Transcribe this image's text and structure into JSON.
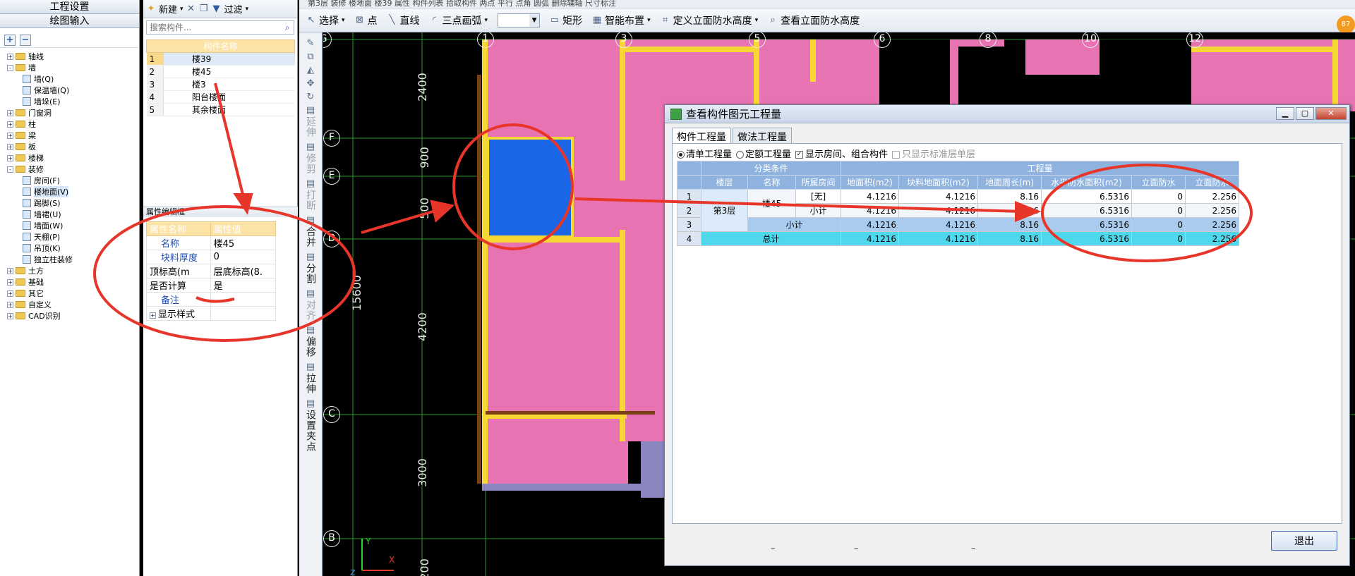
{
  "left_panel": {
    "header1": "工程设置",
    "header2": "绘图输入",
    "tree": [
      {
        "label": "轴线",
        "level": 1,
        "exp": "+"
      },
      {
        "label": "墙",
        "level": 1,
        "exp": "-"
      },
      {
        "label": "墙(Q)",
        "level": 2
      },
      {
        "label": "保温墙(Q)",
        "level": 2
      },
      {
        "label": "墙垛(E)",
        "level": 2
      },
      {
        "label": "门窗洞",
        "level": 1,
        "exp": "+"
      },
      {
        "label": "柱",
        "level": 1,
        "exp": "+"
      },
      {
        "label": "梁",
        "level": 1,
        "exp": "+"
      },
      {
        "label": "板",
        "level": 1,
        "exp": "+"
      },
      {
        "label": "楼梯",
        "level": 1,
        "exp": "+"
      },
      {
        "label": "装修",
        "level": 1,
        "exp": "-"
      },
      {
        "label": "房间(F)",
        "level": 2
      },
      {
        "label": "楼地面(V)",
        "level": 2,
        "selected": true
      },
      {
        "label": "踢脚(S)",
        "level": 2
      },
      {
        "label": "墙裙(U)",
        "level": 2
      },
      {
        "label": "墙面(W)",
        "level": 2
      },
      {
        "label": "天棚(P)",
        "level": 2
      },
      {
        "label": "吊顶(K)",
        "level": 2
      },
      {
        "label": "独立柱装修",
        "level": 2
      },
      {
        "label": "土方",
        "level": 1,
        "exp": "+"
      },
      {
        "label": "基础",
        "level": 1,
        "exp": "+"
      },
      {
        "label": "其它",
        "level": 1,
        "exp": "+"
      },
      {
        "label": "自定义",
        "level": 1,
        "exp": "+"
      },
      {
        "label": "CAD识别",
        "level": 1,
        "exp": "+"
      }
    ]
  },
  "mid_panel": {
    "new_label": "新建",
    "filter_label": "过滤",
    "search_placeholder": "搜索构件...",
    "comp_header": "构件名称",
    "components": [
      {
        "no": "1",
        "name": "楼39",
        "selected": true
      },
      {
        "no": "2",
        "name": "楼45"
      },
      {
        "no": "3",
        "name": "楼3"
      },
      {
        "no": "4",
        "name": "阳台楼面"
      },
      {
        "no": "5",
        "name": "其余楼面"
      }
    ],
    "prop_title": "属性编辑框",
    "prop_headers": [
      "属性名称",
      "属性值"
    ],
    "props": [
      {
        "name": "名称",
        "value": "楼45",
        "blue": true
      },
      {
        "name": "块料厚度",
        "value": "0",
        "blue": true
      },
      {
        "name": "顶标高(m",
        "value": "层底标高(8.",
        "blue": false
      },
      {
        "name": "是否计算",
        "value": "是",
        "blue": false
      },
      {
        "name": "备注",
        "value": "",
        "blue": true
      },
      {
        "name": "显示样式",
        "value": "",
        "blue": false,
        "exp": "+"
      }
    ]
  },
  "vtoolbar": [
    {
      "label": "延伸",
      "dim": true
    },
    {
      "label": "修剪",
      "dim": true
    },
    {
      "label": "打断",
      "dim": true
    },
    {
      "label": "合并",
      "dim": false
    },
    {
      "label": "分割",
      "dim": false
    },
    {
      "label": "对齐",
      "dim": true
    },
    {
      "label": "偏移",
      "dim": false
    },
    {
      "label": "拉伸",
      "dim": false
    },
    {
      "label": "设置夹点",
      "dim": false
    }
  ],
  "top_strip_text": "第3层  装修  楼地面  楼39    属性  构件列表  拾取构件    两点  平行  点角  圆弧    删除辅轴  尺寸标注",
  "main_toolbar": {
    "select": "选择",
    "point": "点",
    "line": "直线",
    "arc": "三点画弧",
    "rect": "矩形",
    "smart": "智能布置",
    "define_wp": "定义立面防水高度",
    "view_wp": "查看立面防水高度"
  },
  "avatar_text": "87",
  "canvas": {
    "axes_top": [
      "G",
      "1",
      "3",
      "5",
      "6",
      "8",
      "10",
      "12"
    ],
    "axes_left": [
      "F",
      "E",
      "D",
      "C",
      "B"
    ],
    "dims": [
      "2400",
      "900",
      "500",
      "15600",
      "4200",
      "3000",
      "200"
    ]
  },
  "dialog": {
    "title": "查看构件图元工程量",
    "tabs": [
      "构件工程量",
      "做法工程量"
    ],
    "opt_list": "清单工程量",
    "opt_quota": "定额工程量",
    "opt_show_room": "显示房间、组合构件",
    "opt_std_floor": "只显示标准层单层",
    "header_group_class": "分类条件",
    "header_group_qty": "工程量",
    "headers": [
      "楼层",
      "名称",
      "所属房间",
      "地面积(m2)",
      "块料地面积(m2)",
      "地面周长(m)",
      "水平防水面积(m2)",
      "立面防水",
      "立面防水"
    ],
    "floor": "第3层",
    "name": "楼45",
    "rows": [
      {
        "no": "1",
        "room": "[无]",
        "a": "4.1216",
        "b": "4.1216",
        "c": "8.16",
        "d": "6.5316",
        "e": "0",
        "f": "2.256"
      },
      {
        "no": "2",
        "room": "小计",
        "a": "4.1216",
        "b": "4.1216",
        "c": "8.16",
        "d": "6.5316",
        "e": "0",
        "f": "2.256"
      },
      {
        "no": "3",
        "label": "小计",
        "a": "4.1216",
        "b": "4.1216",
        "c": "8.16",
        "d": "6.5316",
        "e": "0",
        "f": "2.256"
      },
      {
        "no": "4",
        "label": "总计",
        "a": "4.1216",
        "b": "4.1216",
        "c": "8.16",
        "d": "6.5316",
        "e": "0",
        "f": "2.256"
      }
    ],
    "foot_dashes": [
      "–",
      "–",
      "–"
    ],
    "exit": "退出"
  }
}
